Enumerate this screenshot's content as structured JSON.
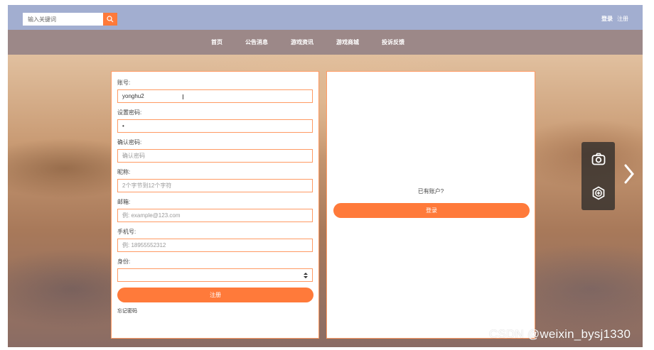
{
  "header": {
    "search_placeholder": "输入关键词",
    "login": "登录",
    "register": "注册"
  },
  "nav": [
    "首页",
    "公告消息",
    "游戏资讯",
    "游戏商城",
    "投诉反馈"
  ],
  "form": {
    "account_label": "账号:",
    "account_value": "yonghu2",
    "password_label": "设置密码:",
    "password_value": "•",
    "confirm_label": "确认密码:",
    "confirm_placeholder": "确认密码",
    "nickname_label": "昵称:",
    "nickname_placeholder": "2个字节到12个字符",
    "email_label": "邮箱:",
    "email_placeholder": "例: example@123.com",
    "phone_label": "手机号:",
    "phone_placeholder": "例: 18955552312",
    "identity_label": "身份:",
    "identity_value": "",
    "register_button": "注册",
    "forgot_link": "忘记密码"
  },
  "side": {
    "has_account": "已有账户?",
    "login_button": "登录"
  },
  "icons": [
    "search-icon",
    "camera-icon",
    "ai-icon",
    "chevron-right-icon",
    "select-arrows-icon"
  ],
  "colors": {
    "accent": "#ff7a3a",
    "topbar": "#a2aed0",
    "navbar": "#9c8888",
    "border": "#ff9a63"
  },
  "watermark": "CSDN @weixin_bysj1330"
}
